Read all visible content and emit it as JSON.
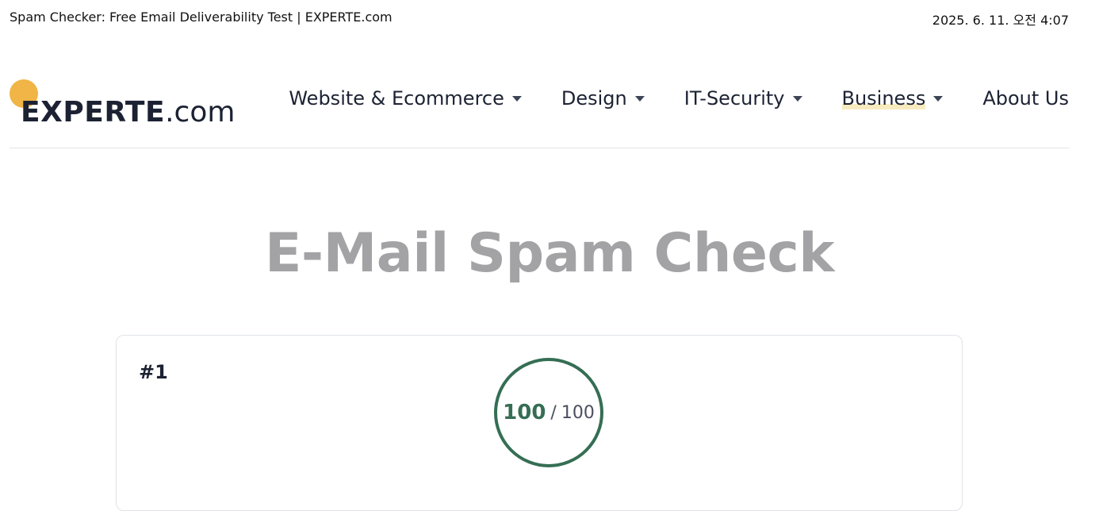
{
  "browser": {
    "page_title": "Spam Checker: Free Email Deliverability Test | EXPERTE.com",
    "datetime": "2025. 6. 11. 오전 4:07"
  },
  "header": {
    "logo": {
      "name": "EXPERTE",
      "suffix": ".com",
      "accent_color": "#f0b546"
    },
    "nav": [
      {
        "label": "Website & Ecommerce",
        "has_dropdown": true,
        "active": false
      },
      {
        "label": "Design",
        "has_dropdown": true,
        "active": false
      },
      {
        "label": "IT-Security",
        "has_dropdown": true,
        "active": false
      },
      {
        "label": "Business",
        "has_dropdown": true,
        "active": true
      },
      {
        "label": "About Us",
        "has_dropdown": false,
        "active": false
      }
    ]
  },
  "main": {
    "title": "E-Mail Spam Check",
    "result": {
      "index": "#1",
      "score": "100",
      "separator": "/",
      "max": "100",
      "score_color": "#356e54"
    }
  },
  "colors": {
    "text": "#1c2233",
    "title_gray": "#a3a3a5",
    "active_underline": "#f8ebbf"
  }
}
